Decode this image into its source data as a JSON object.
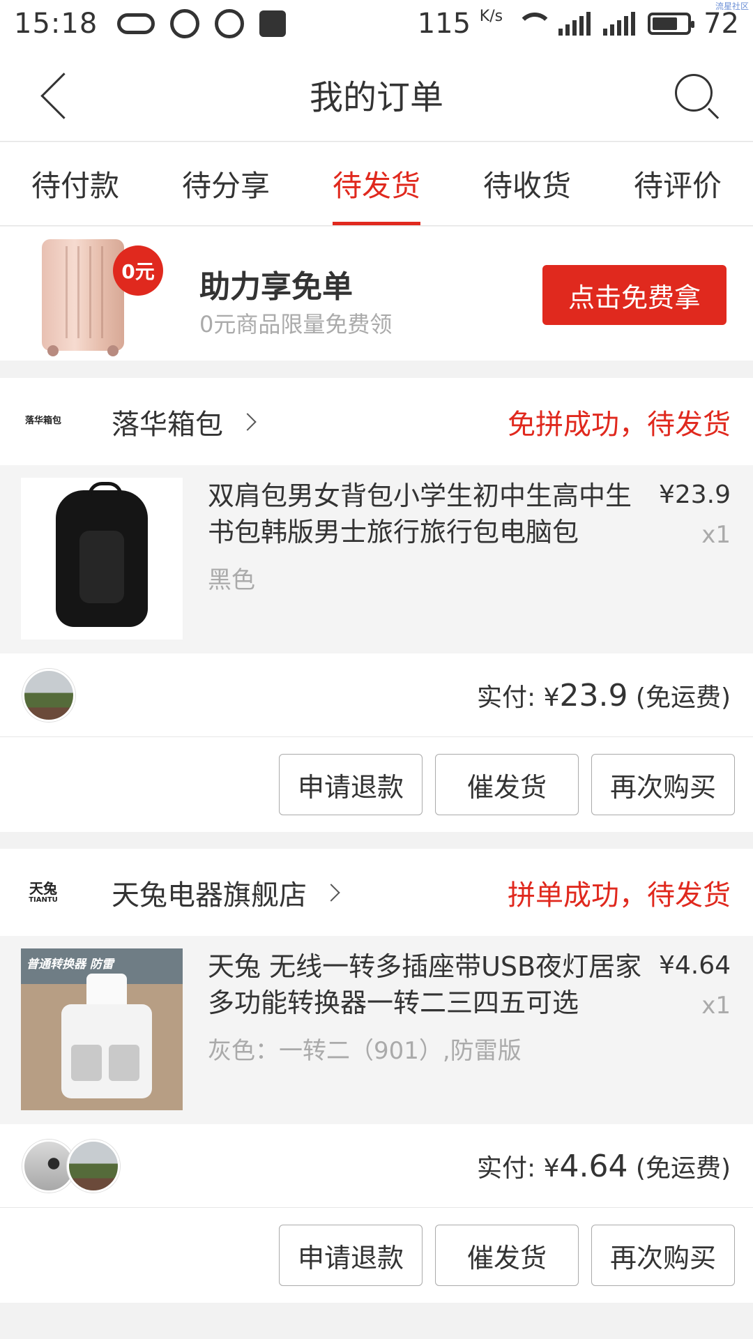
{
  "status_bar": {
    "time": "15:18",
    "speed": "115",
    "speed_unit": "K/s",
    "battery": "72",
    "watermark": "流星社区"
  },
  "header": {
    "title": "我的订单"
  },
  "tabs": [
    {
      "label": "待付款"
    },
    {
      "label": "待分享"
    },
    {
      "label": "待发货"
    },
    {
      "label": "待收货"
    },
    {
      "label": "待评价"
    }
  ],
  "promo": {
    "badge": "0元",
    "title": "助力享免单",
    "subtitle": "0元商品限量免费领",
    "cta": "点击免费拿"
  },
  "orders": [
    {
      "shop_logo": "落华箱包",
      "shop_name": "落华箱包",
      "status": "免拼成功，待发货",
      "item_title": "双肩包男女背包小学生初中生高中生书包韩版男士旅行旅行包电脑包",
      "item_spec": "黑色",
      "price": "¥23.9",
      "qty": "x1",
      "pay_label": "实付: ¥",
      "pay_amount": "23.9",
      "pay_suffix": " (免运费)",
      "actions": [
        "申请退款",
        "催发货",
        "再次购买"
      ]
    },
    {
      "shop_logo": "天兔",
      "shop_logo_sub": "TIANTU",
      "shop_name": "天兔电器旗舰店",
      "status": "拼单成功，待发货",
      "item_title": "天兔 无线一转多插座带USB夜灯居家多功能转换器一转二三四五可选",
      "item_spec": "灰色：一转二（901）,防雷版",
      "image_label": "普通转换器 防雷",
      "price": "¥4.64",
      "qty": "x1",
      "pay_label": "实付: ¥",
      "pay_amount": "4.64",
      "pay_suffix": " (免运费)",
      "actions": [
        "申请退款",
        "催发货",
        "再次购买"
      ]
    }
  ],
  "colors": {
    "accent": "#e0291e",
    "background": "#f2f2f2"
  }
}
